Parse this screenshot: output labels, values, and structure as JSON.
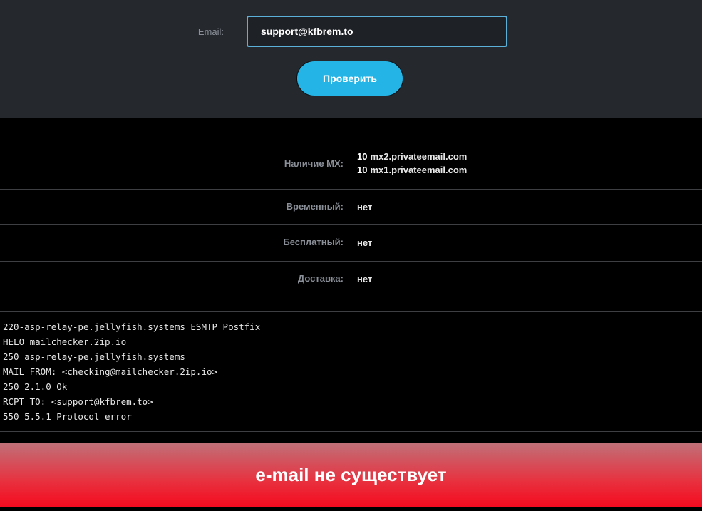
{
  "form": {
    "email_label": "Email:",
    "email_value": "support@kfbrem.to",
    "check_button_label": "Проверить"
  },
  "results": {
    "mx": {
      "label": "Наличие MX:",
      "records": [
        {
          "priority": "10",
          "host": "mx2.privateemail.com"
        },
        {
          "priority": "10",
          "host": "mx1.privateemail.com"
        }
      ]
    },
    "temporary": {
      "label": "Временный:",
      "value": "нет"
    },
    "free": {
      "label": "Бесплатный:",
      "value": "нет"
    },
    "delivery": {
      "label": "Доставка:",
      "value": "нет"
    }
  },
  "smtp_log": [
    "220-asp-relay-pe.jellyfish.systems ESMTP Postfix",
    "HELO mailchecker.2ip.io",
    "250 asp-relay-pe.jellyfish.systems",
    "MAIL FROM: <checking@mailchecker.2ip.io>",
    "250 2.1.0 Ok",
    "RCPT TO: <support@kfbrem.to>",
    "550 5.5.1 Protocol error"
  ],
  "verdict": {
    "text": "e-mail не существует",
    "color": "#f50a1e"
  },
  "colors": {
    "top_panel_bg": "#25282d",
    "accent_button": "#25b4e6",
    "input_border": "#5ab0d8",
    "page_bg": "#000000"
  }
}
